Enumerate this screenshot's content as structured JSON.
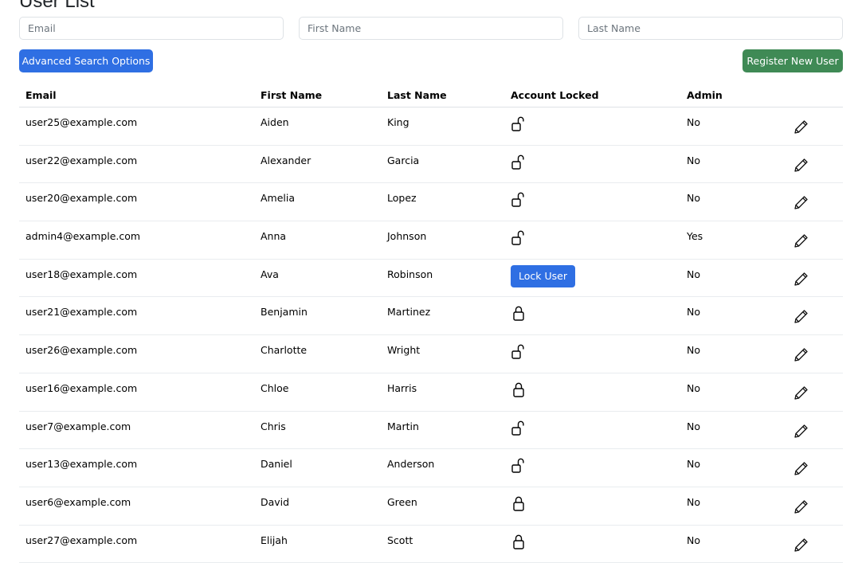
{
  "page": {
    "title": "User List"
  },
  "filters": {
    "email_placeholder": "Email",
    "first_name_placeholder": "First Name",
    "last_name_placeholder": "Last Name"
  },
  "actions": {
    "advanced_search_label": "Advanced Search Options",
    "register_label": "Register New User"
  },
  "colors": {
    "primary": "#2f6fe3",
    "success": "#3f8a55"
  },
  "table": {
    "headers": [
      "Email",
      "First Name",
      "Last Name",
      "Account Locked",
      "Admin"
    ],
    "lock_user_label": "Lock User",
    "rows": [
      {
        "email": "user25@example.com",
        "first": "Aiden",
        "last": "King",
        "locked": "unlocked-icon",
        "admin": "No"
      },
      {
        "email": "user22@example.com",
        "first": "Alexander",
        "last": "Garcia",
        "locked": "unlocked-icon",
        "admin": "No"
      },
      {
        "email": "user20@example.com",
        "first": "Amelia",
        "last": "Lopez",
        "locked": "unlocked-icon",
        "admin": "No"
      },
      {
        "email": "admin4@example.com",
        "first": "Anna",
        "last": "Johnson",
        "locked": "unlocked-icon",
        "admin": "Yes"
      },
      {
        "email": "user18@example.com",
        "first": "Ava",
        "last": "Robinson",
        "locked": "lock-user-button",
        "admin": "No"
      },
      {
        "email": "user21@example.com",
        "first": "Benjamin",
        "last": "Martinez",
        "locked": "locked-icon",
        "admin": "No"
      },
      {
        "email": "user26@example.com",
        "first": "Charlotte",
        "last": "Wright",
        "locked": "unlocked-icon",
        "admin": "No"
      },
      {
        "email": "user16@example.com",
        "first": "Chloe",
        "last": "Harris",
        "locked": "locked-icon",
        "admin": "No"
      },
      {
        "email": "user7@example.com",
        "first": "Chris",
        "last": "Martin",
        "locked": "unlocked-icon",
        "admin": "No"
      },
      {
        "email": "user13@example.com",
        "first": "Daniel",
        "last": "Anderson",
        "locked": "unlocked-icon",
        "admin": "No"
      },
      {
        "email": "user6@example.com",
        "first": "David",
        "last": "Green",
        "locked": "locked-icon",
        "admin": "No"
      },
      {
        "email": "user27@example.com",
        "first": "Elijah",
        "last": "Scott",
        "locked": "locked-icon",
        "admin": "No"
      }
    ]
  }
}
